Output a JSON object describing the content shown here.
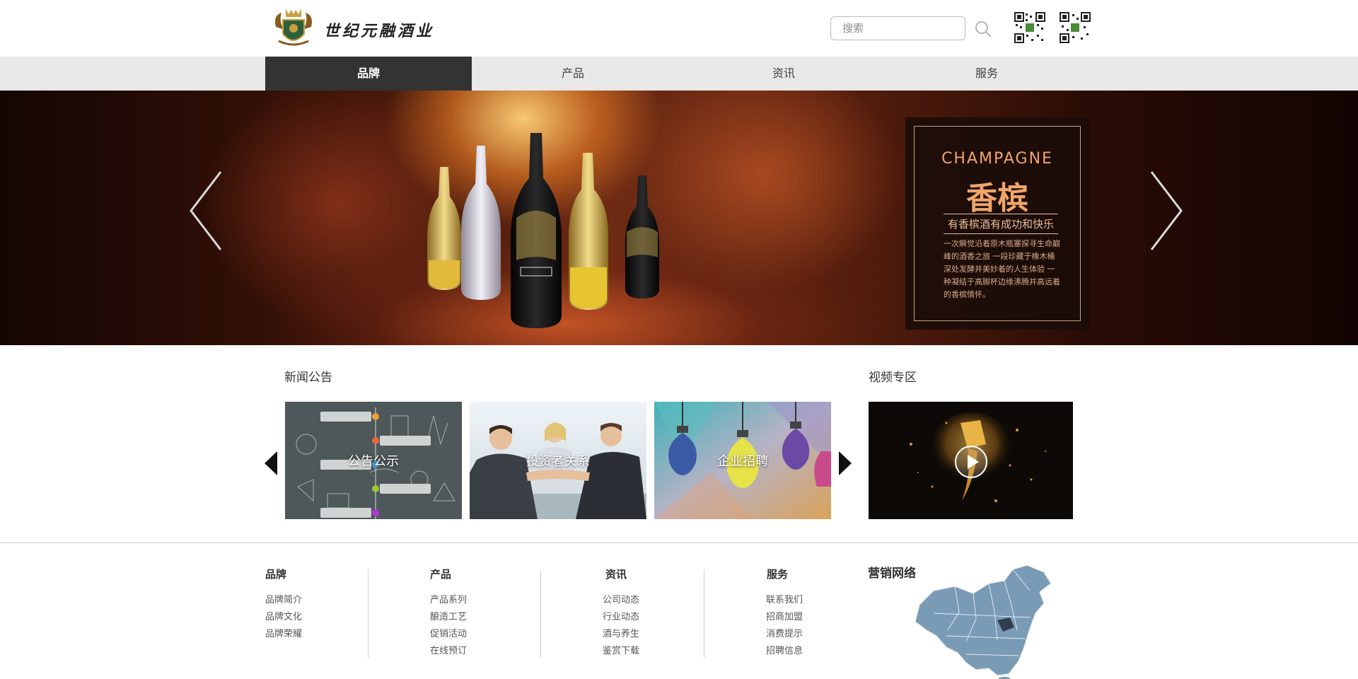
{
  "header": {
    "brand_name": "世纪元融酒业",
    "search": {
      "placeholder": "搜索",
      "value": ""
    }
  },
  "nav": {
    "items": [
      {
        "label": "品牌",
        "active": true
      },
      {
        "label": "产品",
        "active": false
      },
      {
        "label": "资讯",
        "active": false
      },
      {
        "label": "服务",
        "active": false
      }
    ]
  },
  "banner": {
    "promo": {
      "title_en": "CHAMPAGNE",
      "title_cn": "香槟",
      "tagline": "有香槟酒有成功和快乐",
      "description": "一次瞬觉沿着原木瓶塞探寻生命巅峰的酒香之旅 一段珍藏于橡木桶深处发酵并美妙着的人生体验 一种凝结于高脚杯边缘沸腾并高远着的香槟情怀。"
    }
  },
  "news": {
    "title": "新闻公告",
    "cards": [
      {
        "label": "公告公示"
      },
      {
        "label": "投资者关系"
      },
      {
        "label": "企业招聘"
      }
    ]
  },
  "video": {
    "title": "视频专区"
  },
  "footer": {
    "columns": [
      {
        "heading": "品牌",
        "links": [
          "品牌简介",
          "品牌文化",
          "品牌荣耀"
        ]
      },
      {
        "heading": "产品",
        "links": [
          "产品系列",
          "酿造工艺",
          "促销活动",
          "在线预订"
        ]
      },
      {
        "heading": "资讯",
        "links": [
          "公司动态",
          "行业动态",
          "酒与养生",
          "鉴赏下载"
        ]
      },
      {
        "heading": "服务",
        "links": [
          "联系我们",
          "招商加盟",
          "消费提示",
          "招聘信息"
        ]
      }
    ],
    "map_title": "营销网络"
  },
  "colors": {
    "nav_active_bg": "#333333",
    "nav_bg": "#e8e8e8",
    "promo_accent": "#f0a56a"
  }
}
